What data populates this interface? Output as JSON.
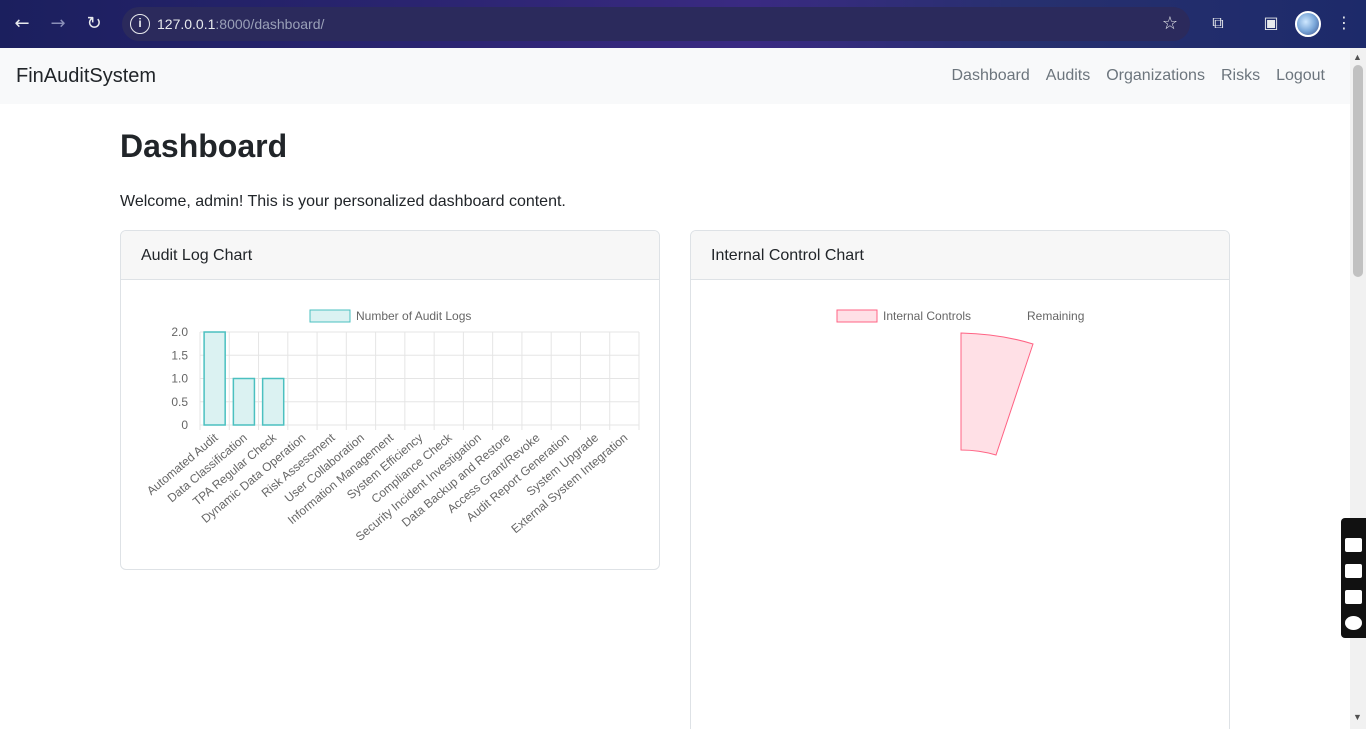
{
  "browser": {
    "url_host": "127.0.0.1",
    "url_rest": ":8000/dashboard/"
  },
  "navbar": {
    "brand": "FinAuditSystem",
    "links": [
      "Dashboard",
      "Audits",
      "Organizations",
      "Risks",
      "Logout"
    ]
  },
  "page": {
    "title": "Dashboard",
    "welcome": "Welcome, admin! This is your personalized dashboard content."
  },
  "cards": {
    "audit_log": {
      "title": "Audit Log Chart"
    },
    "internal_control": {
      "title": "Internal Control Chart"
    }
  },
  "colors": {
    "bar_fill": "#dbf2f2",
    "bar_stroke": "#4bc0c0",
    "pie_fill": "#ffe0e6",
    "pie_stroke": "#ff6384"
  },
  "chart_data": [
    {
      "type": "bar",
      "legend": [
        "Number of Audit Logs"
      ],
      "categories": [
        "Automated Audit",
        "Data Classification",
        "TPA Regular Check",
        "Dynamic Data Operation",
        "Risk Assessment",
        "User Collaboration",
        "Information Management",
        "System Efficiency",
        "Compliance Check",
        "Security Incident Investigation",
        "Data Backup and Restore",
        "Access Grant/Revoke",
        "Audit Report Generation",
        "System Upgrade",
        "External System Integration"
      ],
      "series": [
        {
          "name": "Number of Audit Logs",
          "values": [
            2,
            1,
            1,
            0,
            0,
            0,
            0,
            0,
            0,
            0,
            0,
            0,
            0,
            0,
            0
          ]
        }
      ],
      "yticks": [
        "2.0",
        "1.5",
        "1.0",
        "0.5",
        "0"
      ],
      "ylim": [
        0,
        2
      ],
      "grid": true,
      "legend_position": "top"
    },
    {
      "type": "pie",
      "legend": [
        "Internal Controls",
        "Remaining"
      ],
      "legend_position": "top"
    }
  ]
}
